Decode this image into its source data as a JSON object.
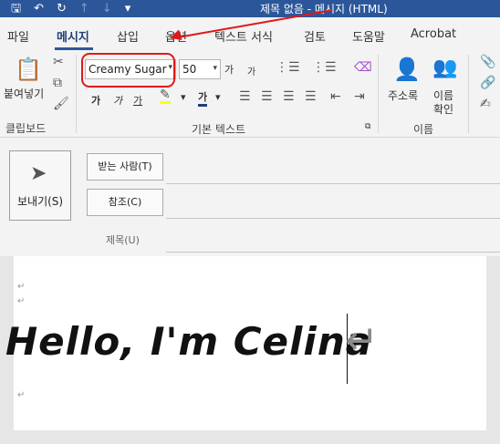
{
  "window": {
    "title": "제목 없음 - 메시지 (HTML)",
    "qat_icons": [
      "save-icon",
      "undo-icon",
      "redo-icon",
      "up-icon",
      "down-icon",
      "customize-icon"
    ]
  },
  "tabs": [
    "파일",
    "메시지",
    "삽입",
    "옵션",
    "텍스트 서식",
    "검토",
    "도움말",
    "Acrobat"
  ],
  "active_tab": "메시지",
  "ribbon": {
    "clipboard": {
      "paste_label": "붙여넣기",
      "group_label": "클립보드"
    },
    "basic_text": {
      "font_name": "Creamy Sugar",
      "font_size": "50",
      "grow_label": "가",
      "shrink_label": "가",
      "bold_label": "가",
      "italic_label": "가",
      "underline_label": "가",
      "font_color_label": "가",
      "group_label": "기본 텍스트"
    },
    "names": {
      "address_book": "주소록",
      "check_names_line1": "이름",
      "check_names_line2": "확인",
      "group_label": "이름"
    }
  },
  "compose": {
    "send_label": "보내기(S)",
    "to_label": "받는 사람(T)",
    "cc_label": "참조(C)",
    "subject_label": "제목(U)",
    "to_value": "",
    "cc_value": "",
    "subject_value": ""
  },
  "body": {
    "text": "Hello, I'm Celina",
    "return_mark": "↵"
  },
  "annotation": {
    "color": "#e01818"
  },
  "colors": {
    "titlebar": "#2b579a",
    "highlight": "#ffff00",
    "font_color": "#1f3f77"
  }
}
